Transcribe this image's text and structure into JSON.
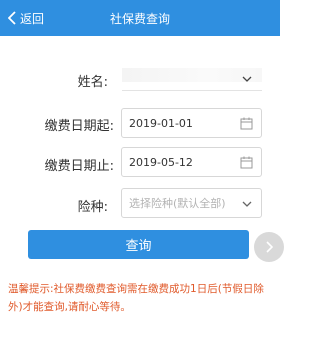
{
  "header": {
    "back_label": "返回",
    "title": "社保费查询"
  },
  "form": {
    "name_label": "姓名:",
    "start_label": "缴费日期起:",
    "start_value": "2019-01-01",
    "end_label": "缴费日期止:",
    "end_value": "2019-05-12",
    "type_label": "险种:",
    "type_placeholder": "选择险种(默认全部)"
  },
  "query_button_label": "查询",
  "tip": "温馨提示:社保费缴费查询需在缴费成功1日后(节假日除外)才能查询,请耐心等待。",
  "colors": {
    "primary": "#2f8fe0",
    "tip": "#e05a2b"
  },
  "icons": [
    "chevron-left-icon",
    "chevron-down-icon",
    "calendar-icon",
    "chevron-right-icon"
  ]
}
